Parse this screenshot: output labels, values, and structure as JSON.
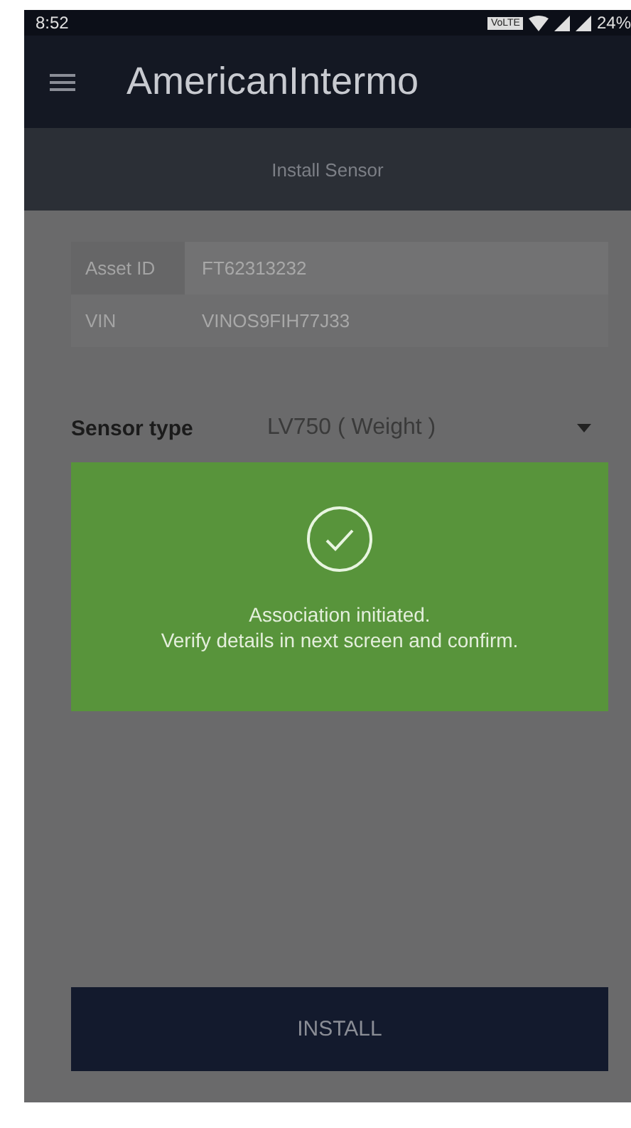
{
  "status_bar": {
    "time": "8:52",
    "network_badge": "VoLTE",
    "battery": "24%"
  },
  "app_bar": {
    "title": "AmericanIntermo"
  },
  "header": {
    "title": "Install Sensor"
  },
  "asset_table": [
    {
      "label": "Asset ID",
      "value": "FT62313232"
    },
    {
      "label": "VIN",
      "value": "VINOS9FIH77J33"
    }
  ],
  "sensor_type": {
    "label": "Sensor type",
    "value": "LV750 ( Weight )"
  },
  "toast": {
    "lines": [
      "Association initiated.",
      "Verify details in next screen and confirm."
    ]
  },
  "install_button": {
    "label": "INSTALL"
  }
}
